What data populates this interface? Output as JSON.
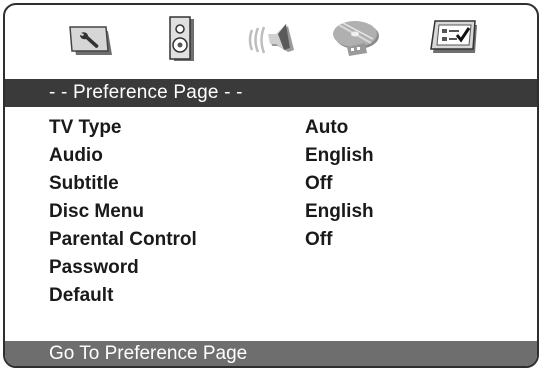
{
  "icons": [
    {
      "name": "setup-icon"
    },
    {
      "name": "audio-speaker-icon"
    },
    {
      "name": "speaker-waves-icon"
    },
    {
      "name": "disc-icon"
    },
    {
      "name": "preference-icon"
    }
  ],
  "header": {
    "title": "- - Preference Page - -"
  },
  "menu": {
    "items": [
      {
        "label": "TV Type",
        "value": "Auto"
      },
      {
        "label": "Audio",
        "value": "English"
      },
      {
        "label": "Subtitle",
        "value": "Off"
      },
      {
        "label": "Disc Menu",
        "value": "English"
      },
      {
        "label": "Parental Control",
        "value": "Off"
      },
      {
        "label": "Password",
        "value": ""
      },
      {
        "label": "Default",
        "value": ""
      }
    ]
  },
  "status": {
    "text": "Go To Preference Page"
  },
  "colors": {
    "header_bg": "#3a3a3a",
    "status_bg": "#6e6e6e",
    "text": "#1a1a1a",
    "frame": "#2e2e2e"
  }
}
